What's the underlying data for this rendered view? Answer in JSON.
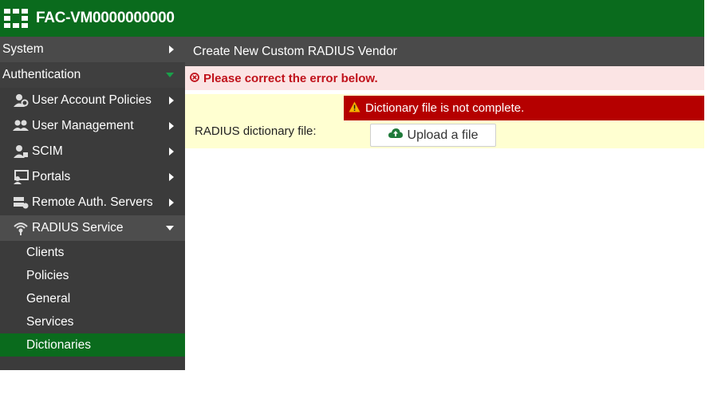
{
  "header": {
    "hostname": "FAC-VM0000000000"
  },
  "sidebar": {
    "categories": [
      {
        "label": "System"
      },
      {
        "label": "Authentication"
      }
    ],
    "items": [
      {
        "label": "User Account Policies",
        "icon": "user-policies-icon"
      },
      {
        "label": "User Management",
        "icon": "users-icon"
      },
      {
        "label": "SCIM",
        "icon": "scim-icon"
      },
      {
        "label": "Portals",
        "icon": "portals-icon"
      },
      {
        "label": "Remote Auth. Servers",
        "icon": "servers-icon"
      },
      {
        "label": "RADIUS Service",
        "icon": "radius-icon"
      }
    ],
    "radius_children": [
      {
        "label": "Clients"
      },
      {
        "label": "Policies"
      },
      {
        "label": "General"
      },
      {
        "label": "Services"
      },
      {
        "label": "Dictionaries"
      }
    ]
  },
  "main": {
    "title": "Create New Custom RADIUS Vendor",
    "error_banner": "Please correct the error below.",
    "field_error": "Dictionary file is not complete.",
    "field_label": "RADIUS dictionary file:",
    "upload_button": "Upload a file"
  },
  "colors": {
    "brand_green": "#0a6b1d",
    "sidebar_bg": "#3b3b3b",
    "error_red": "#b50000",
    "form_bg": "#ffffd1"
  }
}
